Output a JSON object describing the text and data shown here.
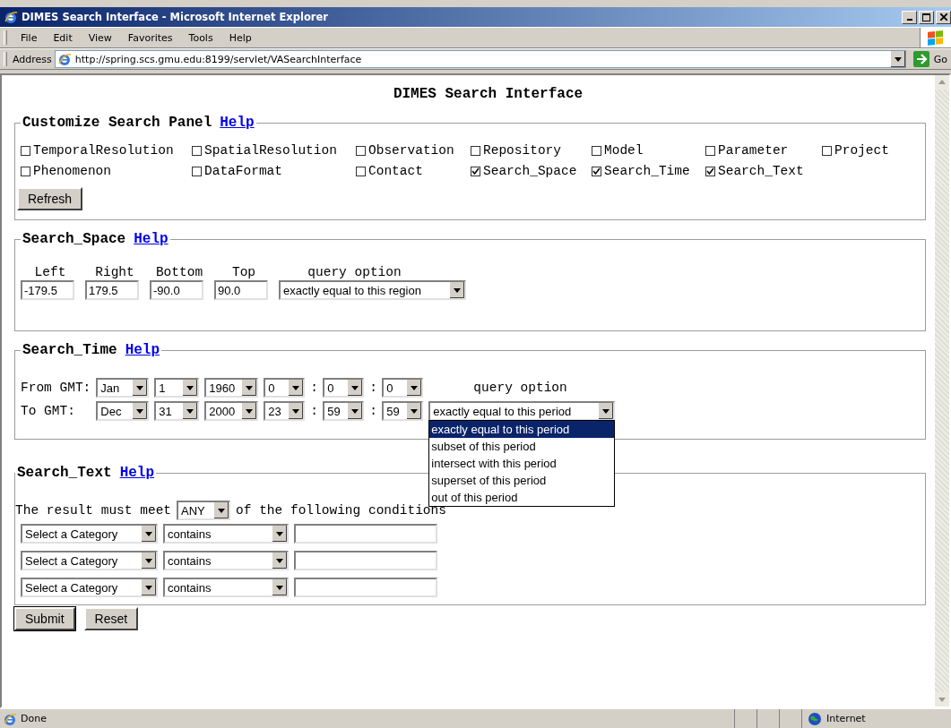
{
  "window": {
    "title": "DIMES Search Interface - Microsoft Internet Explorer"
  },
  "menu_bar": [
    "File",
    "Edit",
    "View",
    "Favorites",
    "Tools",
    "Help"
  ],
  "address_bar": {
    "label": "Address",
    "url": "http://spring.scs.gmu.edu:8199/servlet/VASearchInterface",
    "go_label": "Go"
  },
  "page": {
    "heading": "DIMES Search Interface"
  },
  "customize_panel": {
    "title": "Customize Search Panel",
    "help_link": "Help",
    "options": [
      {
        "label": "TemporalResolution",
        "checked": false
      },
      {
        "label": "SpatialResolution",
        "checked": false
      },
      {
        "label": "Observation",
        "checked": false
      },
      {
        "label": "Repository",
        "checked": false
      },
      {
        "label": "Model",
        "checked": false
      },
      {
        "label": "Parameter",
        "checked": false
      },
      {
        "label": "Project",
        "checked": false
      },
      {
        "label": "Phenomenon",
        "checked": false
      },
      {
        "label": "DataFormat",
        "checked": false
      },
      {
        "label": "Contact",
        "checked": false
      },
      {
        "label": "Search_Space",
        "checked": true
      },
      {
        "label": "Search_Time",
        "checked": true
      },
      {
        "label": "Search_Text",
        "checked": true
      }
    ],
    "refresh_button": "Refresh"
  },
  "search_space": {
    "title": "Search_Space",
    "help_link": "Help",
    "fields": [
      {
        "label": "Left",
        "value": "-179.5"
      },
      {
        "label": "Right",
        "value": "179.5"
      },
      {
        "label": "Bottom",
        "value": "-90.0"
      },
      {
        "label": "Top",
        "value": "90.0"
      }
    ],
    "query_option": {
      "label": "query option",
      "value": "exactly equal to this region"
    }
  },
  "search_time": {
    "title": "Search_Time",
    "help_link": "Help",
    "rows": [
      {
        "label": "From GMT:",
        "month": "Jan",
        "day": "1",
        "year": "1960",
        "hour": "0",
        "minute": "0",
        "second": "0",
        "separators": [
          ":",
          ":"
        ]
      },
      {
        "label": "To GMT:",
        "month": "Dec",
        "day": "31",
        "year": "2000",
        "hour": "23",
        "minute": "59",
        "second": "59",
        "separators": [
          ":",
          ":"
        ]
      }
    ],
    "query_option": {
      "label": "query option",
      "value": "exactly equal to this period",
      "dropdown": {
        "items": [
          {
            "label": "exactly equal to this period",
            "selected": true
          },
          {
            "label": "subset of this period",
            "selected": false
          },
          {
            "label": "intersect with this period",
            "selected": false
          },
          {
            "label": "superset of this period",
            "selected": false
          },
          {
            "label": "out of this period",
            "selected": false
          }
        ]
      }
    }
  },
  "search_text": {
    "title": "Search_Text",
    "help_link": "Help",
    "sentence_before": "The result must meet",
    "match": "ANY",
    "sentence_after": "of the following conditions",
    "conditions": [
      {
        "category": "Select a Category",
        "operator": "contains"
      },
      {
        "category": "Select a Category",
        "operator": "contains"
      },
      {
        "category": "Select a Category",
        "operator": "contains"
      }
    ]
  },
  "buttons": [
    "Submit",
    "Reset"
  ],
  "status_bar": {
    "text": "Done",
    "zone": "Internet"
  }
}
